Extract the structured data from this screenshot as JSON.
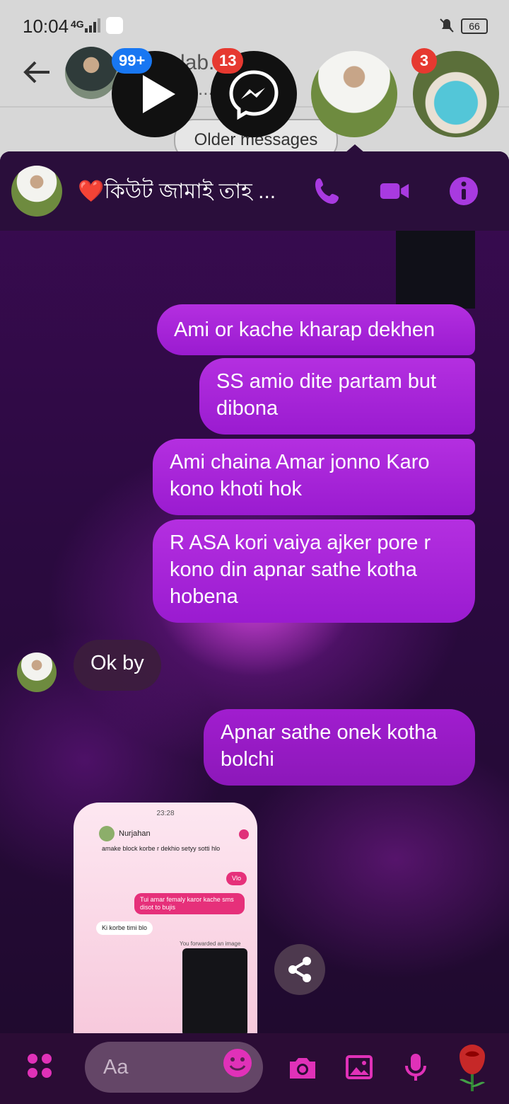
{
  "status_bar": {
    "time": "10:04",
    "network": "4G",
    "battery": "66"
  },
  "background_screen": {
    "title": "...lab...m...",
    "subtitle": "...ow...",
    "older_messages": "Older messages"
  },
  "chat_heads": [
    {
      "type": "video-app",
      "badge": "99+",
      "badge_color": "#1877f2"
    },
    {
      "type": "messenger",
      "badge": "13",
      "badge_color": "#e63930"
    },
    {
      "type": "person-active"
    },
    {
      "type": "person",
      "badge": "3",
      "badge_color": "#e63930"
    }
  ],
  "chat": {
    "name": "❤️কিউট জামাই তাহ ...",
    "accent": "#b42fe0",
    "messages": [
      {
        "from": "me",
        "text": "Ami or kache kharap dekhen"
      },
      {
        "from": "me",
        "text": "SS amio dite partam but dibona"
      },
      {
        "from": "me",
        "text": "Ami chaina Amar jonno Karo kono khoti hok"
      },
      {
        "from": "me",
        "text": "R ASA kori vaiya ajker pore r kono din apnar sathe kotha hobena"
      },
      {
        "from": "them",
        "text": "Ok by"
      },
      {
        "from": "me",
        "text": "Apnar sathe onek kotha bolchi"
      }
    ],
    "shared_image": {
      "time": "23:28",
      "contact": "Nurjahan",
      "line1": "amake block korbe r dekhio setyy sotti hlo",
      "reply1": "Vlo",
      "sent": "Tui amar femaly karor kache sms disot to bujis",
      "recv": "Ki korbe timi blo",
      "forwarded": "You forwarded an image"
    }
  },
  "composer": {
    "placeholder": "Aa"
  }
}
